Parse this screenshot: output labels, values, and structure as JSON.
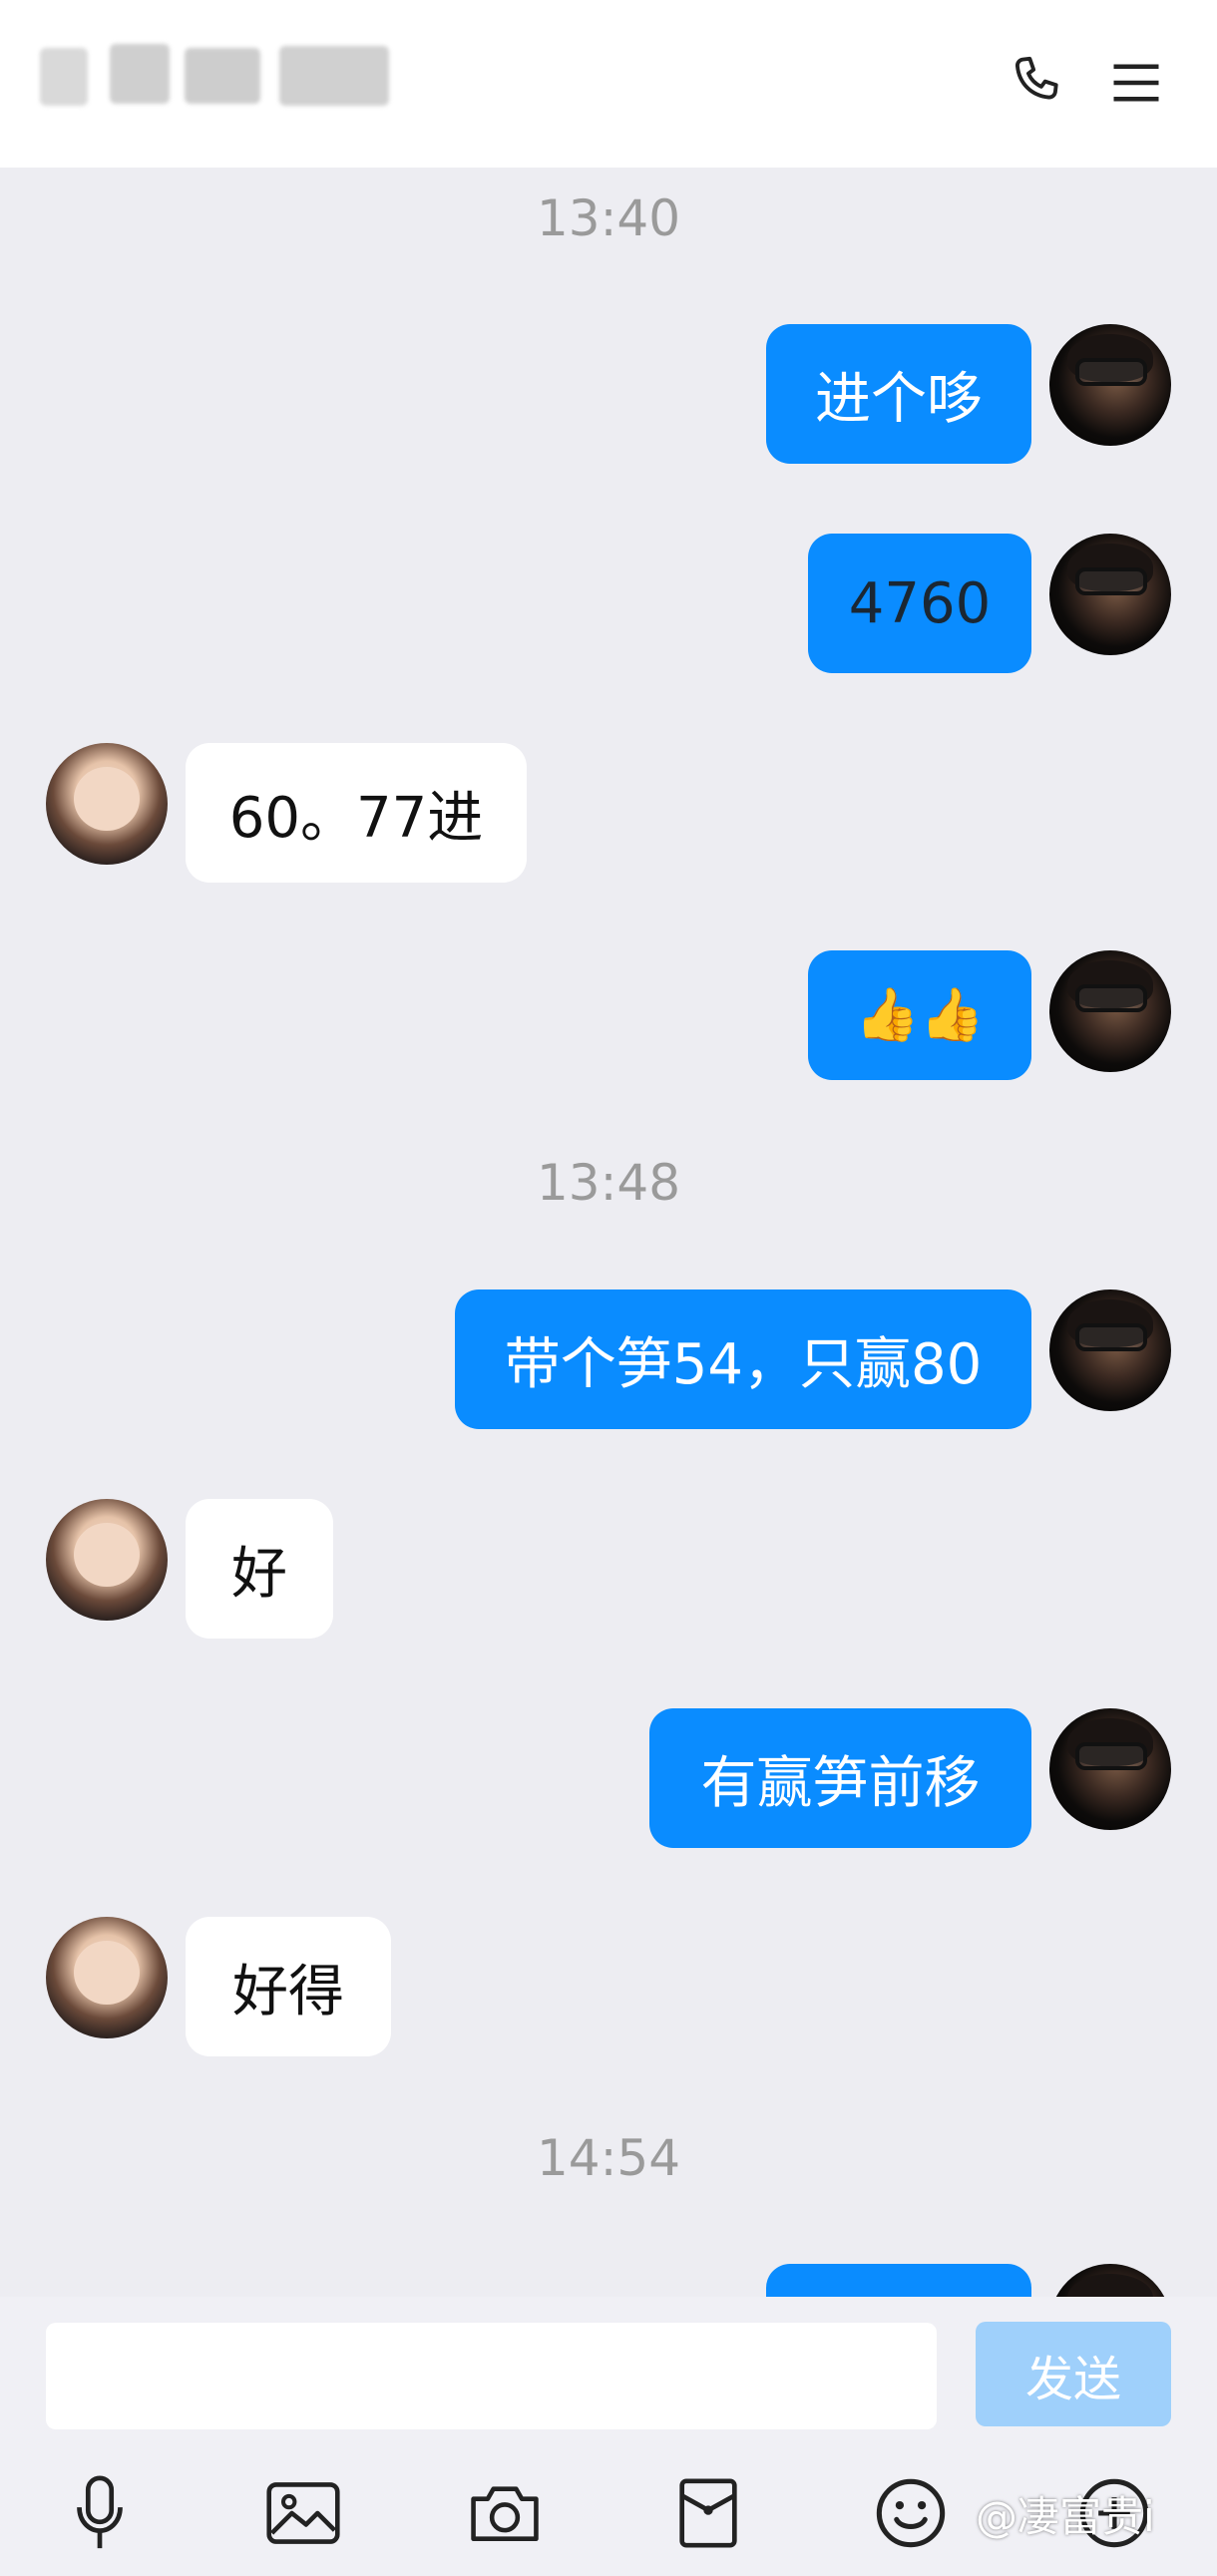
{
  "header": {
    "icons": [
      "phone-icon",
      "menu-icon"
    ]
  },
  "timestamps": [
    "13:40",
    "13:48",
    "14:54"
  ],
  "messages": [
    {
      "side": "out",
      "text": "进个哆"
    },
    {
      "side": "out",
      "text": "4760"
    },
    {
      "side": "in",
      "text": "60。77进"
    },
    {
      "side": "out",
      "text": "👍👍",
      "icon": "thumbs-up-icon"
    },
    {
      "side": "out",
      "text": "带个笋54，只赢80"
    },
    {
      "side": "in",
      "text": "好"
    },
    {
      "side": "out",
      "text": "有赢笋前移"
    },
    {
      "side": "in",
      "text": "好得"
    },
    {
      "side": "out",
      "text": ""
    }
  ],
  "input": {
    "value": "",
    "send_label": "发送"
  },
  "toolbar": {
    "icons": [
      "microphone-icon",
      "image-icon",
      "camera-icon",
      "red-packet-icon",
      "emoji-icon",
      "plus-icon"
    ]
  },
  "watermark": "@凄富贵i",
  "colors": {
    "bubble_out": "#0a8cff",
    "bubble_in": "#ffffff",
    "background": "#ededf2",
    "send_disabled": "#9fd0fb"
  }
}
